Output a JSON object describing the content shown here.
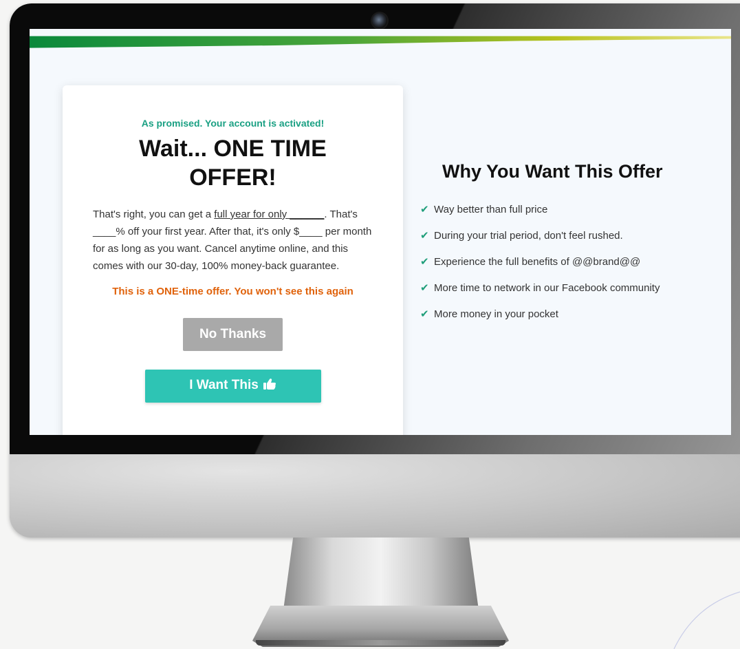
{
  "offer": {
    "kicker": "As promised. Your account is activated!",
    "headline": "Wait... ONE TIME OFFER!",
    "body": {
      "part1": "That's right, you can get a ",
      "link": "full year for only ______",
      "part2": ". That's ____% off your first year. After that, it's only $____ per month for as long as you want. Cancel anytime online, and this comes with our 30-day, 100% money-back guarantee."
    },
    "warning": "This is a ONE-time offer. You won't see this again",
    "no_thanks_label": "No Thanks",
    "want_label": "I Want This"
  },
  "benefits": {
    "title": "Why You Want This Offer",
    "items": [
      "Way better than full price",
      "During your trial period, don't feel rushed.",
      "Experience the full benefits of @@brand@@",
      "More time to network in our Facebook community",
      "More money in your pocket"
    ]
  },
  "colors": {
    "kicker": "#1aa083",
    "warning": "#e0620b",
    "primary_button": "#2ec4b4",
    "secondary_button": "#a9a9a9",
    "check": "#1f9e7a"
  },
  "icons": {
    "check": "check-icon",
    "thumbs_up": "thumbs-up-icon",
    "camera": "webcam-icon"
  }
}
